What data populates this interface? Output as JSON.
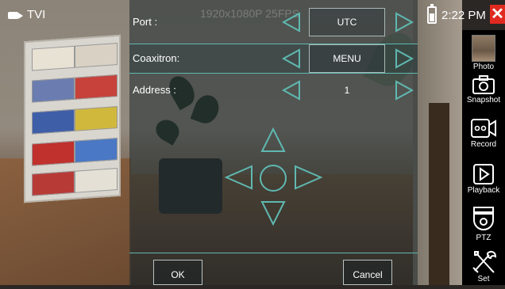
{
  "top_bar": {
    "mode": "TVI",
    "resolution": "1920x1080P 25FPS",
    "time": "2:22 PM",
    "close_glyph": "✕",
    "battery_icon": "battery-icon",
    "mode_icon": "camera-icon"
  },
  "menu": {
    "rows": [
      {
        "label": "Port :",
        "value": "UTC"
      },
      {
        "label": "Coaxitron:",
        "value": "MENU"
      },
      {
        "label": "Address :",
        "value": "1"
      }
    ]
  },
  "ptz_pad": {
    "icons": [
      "up-arrow-icon",
      "down-arrow-icon",
      "left-arrow-icon",
      "right-arrow-icon",
      "center-circle-icon"
    ]
  },
  "footer": {
    "ok_label": "OK",
    "cancel_label": "Cancel"
  },
  "sidebar": {
    "items": [
      {
        "label": "Photo",
        "icon": "photo-thumbnail"
      },
      {
        "label": "Snapshot",
        "icon": "camera-icon"
      },
      {
        "label": "Record",
        "icon": "video-camera-icon"
      },
      {
        "label": "Playback",
        "icon": "play-icon"
      },
      {
        "label": "PTZ",
        "icon": "dome-camera-icon"
      },
      {
        "label": "Set",
        "icon": "tools-icon"
      }
    ]
  },
  "colors": {
    "accent": "#5fb8b0",
    "close": "#e02a1f",
    "sidebar_bg": "#000000"
  }
}
